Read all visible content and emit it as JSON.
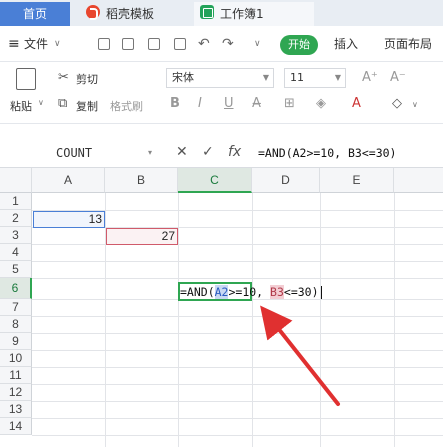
{
  "tabs": {
    "home": "首页",
    "wps": "稻壳模板",
    "sheet": "工作簿1"
  },
  "menubar": {
    "file": "文件",
    "start": "开始",
    "insert": "插入",
    "page_layout": "页面布局"
  },
  "ribbon": {
    "paste": "粘贴",
    "cut": "剪切",
    "copy": "复制",
    "format_painter": "格式刷",
    "font_name": "宋体",
    "font_size": "11",
    "bold": "B",
    "italic": "I",
    "underline": "U",
    "grow": "A⁺",
    "shrink": "A⁻"
  },
  "formula_bar": {
    "name_box": "COUNT",
    "cancel": "✕",
    "confirm": "✓",
    "fx": "fx",
    "formula": "=AND(A2>=10, B3<=30)"
  },
  "columns": [
    "A",
    "B",
    "C",
    "D",
    "E"
  ],
  "rows": [
    "1",
    "2",
    "3",
    "4",
    "5",
    "6",
    "7",
    "8",
    "9",
    "10",
    "11",
    "12",
    "13",
    "14"
  ],
  "cells": {
    "a2": "13",
    "b3": "27"
  },
  "editing": {
    "prefix": "=AND(",
    "ref1": "A2",
    "mid": ">=10, ",
    "ref2": "B3",
    "suffix": "<=30)"
  },
  "colors": {
    "accent": "#2fa652",
    "ref_a2": "#4a7fd6",
    "ref_b3": "#d05a6a",
    "arrow": "#e03030"
  }
}
